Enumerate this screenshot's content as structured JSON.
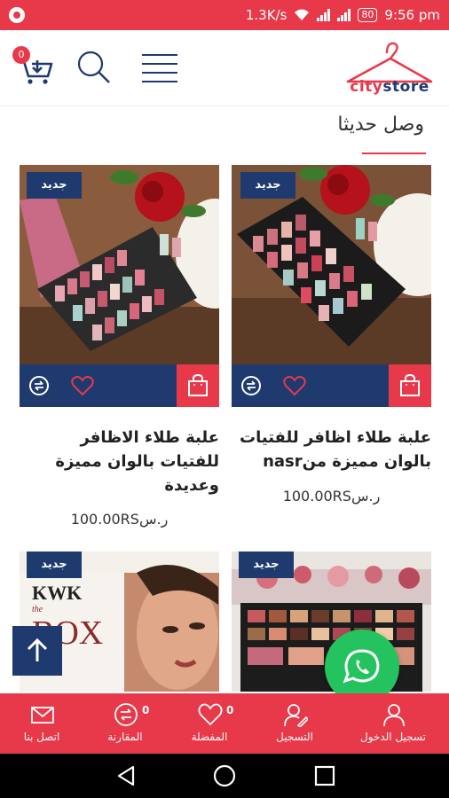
{
  "status_bar": {
    "speed": "1.3K/s",
    "battery": "80",
    "time": "9:56 pm"
  },
  "header": {
    "cart_count": "0",
    "logo_text_city": "city",
    "logo_text_store": "store"
  },
  "section": {
    "title": "وصل حديثا"
  },
  "products": [
    {
      "badge": "جديد",
      "name": "علبة طلاء اظافر للفتيات بالوان مميزة منnasr",
      "price": "100.00RSر.س"
    },
    {
      "badge": "جديد",
      "name": "علبة طلاء الاظافر للفتيات بالوان مميزة وعديدة",
      "price": "100.00RSر.س"
    },
    {
      "badge": "جديد",
      "image_text_brand": "KWK",
      "image_text_box": "BOX",
      "image_text_the": "the"
    },
    {
      "badge": "جديد"
    }
  ],
  "bottom_nav": {
    "items": [
      {
        "label": "تسجيل الدخول",
        "icon": "user-icon"
      },
      {
        "label": "التسجيل",
        "icon": "user-edit-icon"
      },
      {
        "label": "المفضلة",
        "icon": "heart-icon",
        "count": "0"
      },
      {
        "label": "المقارنة",
        "icon": "compare-icon",
        "count": "0"
      },
      {
        "label": "اتصل بنا",
        "icon": "mail-icon"
      }
    ]
  },
  "colors": {
    "primary_red": "#e8394a",
    "navy": "#1f3a6e",
    "whatsapp_green": "#25c35f"
  }
}
